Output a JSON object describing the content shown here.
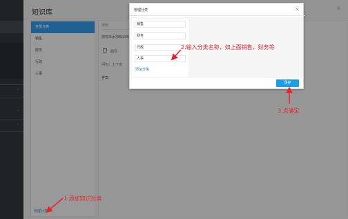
{
  "panel": {
    "title": "知识库",
    "close": "✕",
    "categories": [
      {
        "label": "全部分类"
      },
      {
        "label": "销售"
      },
      {
        "label": "财务"
      },
      {
        "label": "行政"
      },
      {
        "label": "人事"
      }
    ],
    "manage_link": "管理分类",
    "search_placeholder": "搜索",
    "list_text": "您暂未添加知识库文档",
    "row_text": "请问",
    "form_label_1": "问句：上下文",
    "form_label_2": "答案："
  },
  "modal": {
    "title": "管理分类",
    "close": "×",
    "inputs": [
      "销售",
      "财务",
      "行政",
      "人事"
    ],
    "add_link": "添加分类",
    "save_button": "保存"
  },
  "annotations": {
    "step1": "1.添加知识分类",
    "step2": "2.输入分类名称，如上面销售，财务等",
    "step3": "3.点确定"
  },
  "colors": {
    "accent_blue": "#1b9de8",
    "annotation_red": "#e8242a",
    "active_category": "#2f8ad2"
  }
}
